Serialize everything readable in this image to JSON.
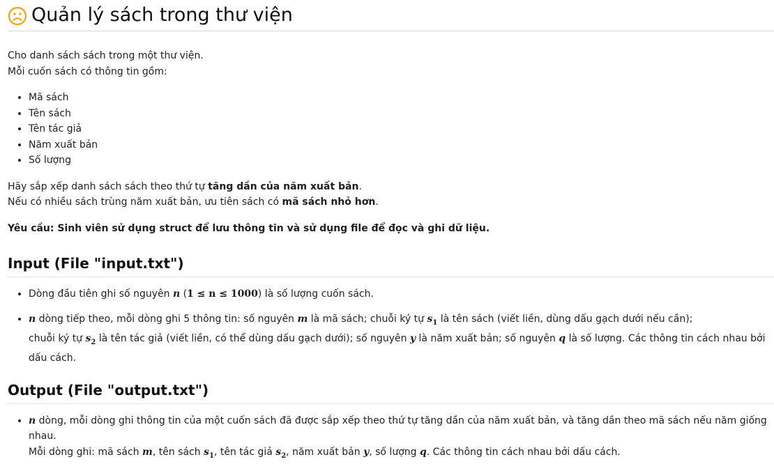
{
  "title": "Quản lý sách trong thư viện",
  "intro": {
    "line1": "Cho danh sách sách trong một thư viện.",
    "line2": "Mỗi cuốn sách có thông tin gồm:"
  },
  "fields": [
    "Mã sách",
    "Tên sách",
    "Tên tác giả",
    "Năm xuất bản",
    "Số lượng"
  ],
  "sort_rule": {
    "l1_pre": "Hãy sắp xếp danh sách sách theo thứ tự ",
    "l1_bold": "tăng dần của năm xuất bản",
    "l1_post": ".",
    "l2_pre": "Nếu có nhiều sách trùng năm xuất bản, ưu tiên sách có ",
    "l2_bold": "mã sách nhỏ hơn",
    "l2_post": "."
  },
  "requirement": "Yêu cầu: Sinh viên sử dụng struct để lưu thông tin và sử dụng file để đọc và ghi dữ liệu.",
  "input": {
    "heading": "Input (File \"input.txt\")",
    "b1": {
      "pre": "Dòng đầu tiên ghi số nguyên ",
      "var_n": "n",
      "range_open": " (",
      "range": "1 ≤ n ≤ 1000",
      "range_close": ")",
      "post": " là số lượng cuốn sách."
    },
    "b2": {
      "var_n": "n",
      "t1": " dòng tiếp theo, mỗi dòng ghi 5 thông tin: số nguyên ",
      "var_m": "m",
      "t2": " là mã sách; chuỗi ký tự ",
      "var_s": "s",
      "sub1": "1",
      "t3": " là tên sách (viết liền, dùng dấu gạch dưới nếu cần);",
      "t4": "chuỗi ký tự ",
      "sub2": "2",
      "t5": " là tên tác giả (viết liền, có thể dùng dấu gạch dưới); số nguyên ",
      "var_y": "y",
      "t6": " là năm xuất bản; số nguyên ",
      "var_q": "q",
      "t7": " là số lượng. Các thông tin cách nhau bởi dấu cách."
    }
  },
  "output": {
    "heading": "Output (File \"output.txt\")",
    "b1": {
      "var_n": "n",
      "t1": " dòng, mỗi dòng ghi thông tin của một cuốn sách đã được sắp xếp theo thứ tự tăng dần của năm xuất bản, và tăng dần theo mã sách nếu năm giống nhau.",
      "t2": "Mỗi dòng ghi: mã sách ",
      "var_m": "m",
      "t3": ", tên sách ",
      "var_s": "s",
      "sub1": "1",
      "t4": ", tên tác giả ",
      "sub2": "2",
      "t5": ", năm xuất bản ",
      "var_y": "y",
      "t6": ", số lượng ",
      "var_q": "q",
      "t7": ". Các thông tin cách nhau bởi dấu cách."
    }
  },
  "colors": {
    "sad_icon": "#f5a623",
    "text": "#1f1f1f",
    "rule": "#d7dde3"
  },
  "icon": "sad-face-icon"
}
